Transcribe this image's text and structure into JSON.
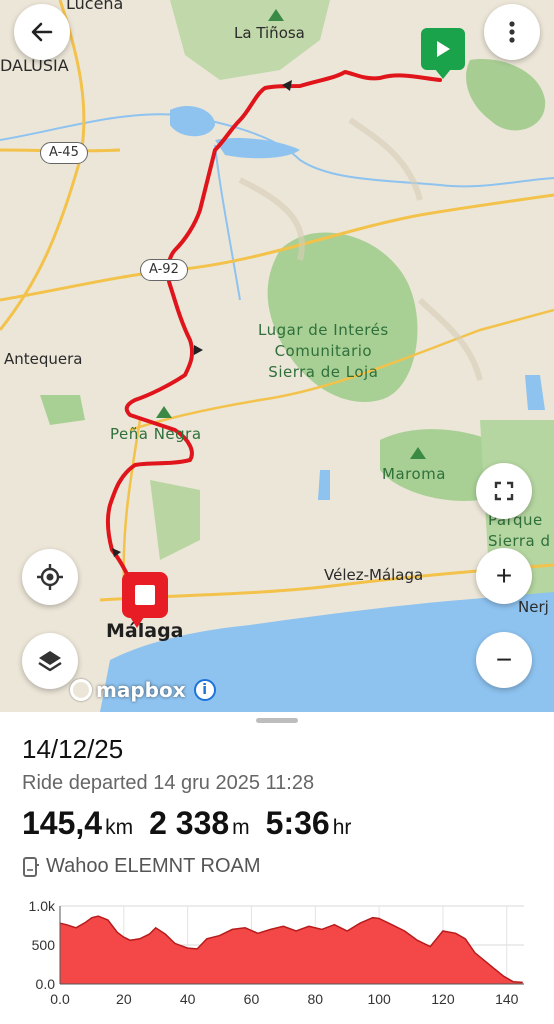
{
  "map": {
    "labels": {
      "lucena": "Lucena",
      "andalusia": "DALUSIA",
      "la_tinosa": "La Tiñosa",
      "antequera": "Antequera",
      "pena_negra": "Peña Negra",
      "lugar": "Lugar de Interés\nComunitario\nSierra de Loja",
      "maroma": "Maroma",
      "velez": "Vélez-Málaga",
      "malaga": "Málaga",
      "nerja": "Nerj",
      "parque": "Parque\nSierra d\nA"
    },
    "roads": {
      "a45": "A-45",
      "a92": "A-92"
    },
    "attribution": "mapbox",
    "colors": {
      "route": "#e0151c",
      "start": "#1aa34a",
      "end": "#e81c24",
      "water": "#8ec3f0",
      "forest": "#9fcf8d"
    }
  },
  "buttons": {
    "back": "back-arrow-icon",
    "menu": "more-vertical-icon",
    "fullscreen": "fullscreen-icon",
    "zoom_in": "+",
    "zoom_out": "−",
    "locate": "my-location-icon",
    "layers": "layers-icon"
  },
  "ride": {
    "date": "14/12/25",
    "subtitle": "Ride departed 14 gru 2025 11:28",
    "distance": "145,4",
    "distance_unit": "km",
    "elevation": "2 338",
    "elevation_unit": "m",
    "duration": "5:36",
    "duration_unit": "hr",
    "device": "Wahoo ELEMNT ROAM"
  },
  "chart_data": {
    "type": "area",
    "x": [
      0,
      2,
      5,
      8,
      10,
      12,
      15,
      18,
      20,
      22,
      25,
      28,
      30,
      33,
      36,
      40,
      43,
      46,
      50,
      54,
      58,
      62,
      66,
      70,
      74,
      78,
      82,
      86,
      90,
      94,
      98,
      100,
      104,
      108,
      112,
      116,
      120,
      124,
      127,
      130,
      133,
      136,
      139,
      142,
      145
    ],
    "values": [
      780,
      760,
      720,
      790,
      850,
      870,
      820,
      660,
      600,
      560,
      580,
      640,
      720,
      640,
      520,
      460,
      450,
      580,
      620,
      700,
      720,
      650,
      700,
      740,
      680,
      740,
      700,
      760,
      680,
      780,
      850,
      840,
      760,
      680,
      560,
      480,
      680,
      650,
      580,
      400,
      300,
      200,
      100,
      30,
      20
    ],
    "yticks": [
      "0.0",
      "500",
      "1.0k"
    ],
    "xticks": [
      "0.0",
      "20",
      "40",
      "60",
      "80",
      "100",
      "120",
      "140"
    ],
    "xlim": [
      0,
      145.4
    ],
    "ylim": [
      0,
      1000
    ],
    "fill_color": "#f44848",
    "line_color": "#b71c1c",
    "grid": true
  }
}
